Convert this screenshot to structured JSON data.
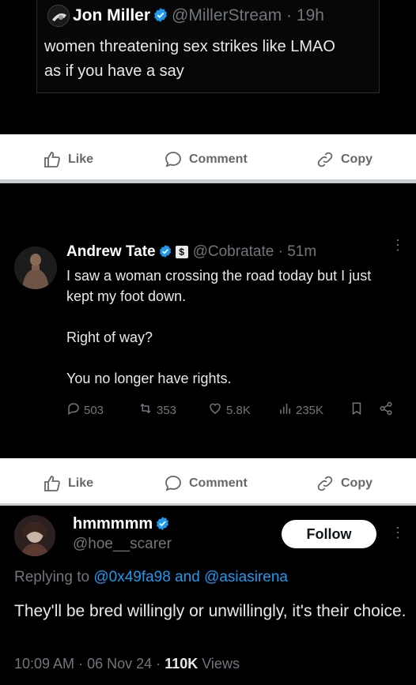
{
  "tweet_top": {
    "name": "Jon Miller",
    "handle": "@MillerStream",
    "sep": "·",
    "time": "19h",
    "text_line1": "women threatening sex strikes like LMAO",
    "text_line2": "as if you have a say"
  },
  "action_bar_1": {
    "like": "Like",
    "comment": "Comment",
    "copy": "Copy"
  },
  "tweet_tate": {
    "name": "Andrew Tate",
    "badge": "$",
    "handle": "@Cobratate",
    "sep": "·",
    "time": "51m",
    "more": "⋮",
    "p1": "I saw a woman crossing the road today but I just kept my foot down.",
    "p2": "Right of way?",
    "p3": "You no longer have rights.",
    "stats": {
      "replies": "503",
      "reposts": "353",
      "likes": "5.8K",
      "views": "235K"
    }
  },
  "action_bar_2": {
    "like": "Like",
    "comment": "Comment",
    "copy": "Copy"
  },
  "tweet_reply": {
    "name": "hmmmmm",
    "handle": "@hoe__scarer",
    "follow": "Follow",
    "more": "⋮",
    "replying_prefix": "Replying to",
    "mention1": "@0x49fa98",
    "and": "and",
    "mention2": "@asiasirena",
    "text": "They'll be bred willingly or unwillingly, it's their choice.",
    "time": "10:09 AM",
    "date": "06 Nov 24",
    "sep": "·",
    "views_count": "110K",
    "views_label": "Views"
  },
  "colors": {
    "background": "#000000",
    "text": "#e7e9ea",
    "muted": "#71767b",
    "link": "#1d9bf0",
    "verified": "#1d9bf0",
    "action_bar_bg": "#ffffff",
    "action_text": "#65676b"
  },
  "icons": [
    "verified-badge-icon",
    "like-thumb-icon",
    "comment-bubble-icon",
    "copy-link-icon",
    "reply-icon",
    "repost-icon",
    "heart-icon",
    "views-icon",
    "bookmark-icon",
    "share-icon",
    "more-vertical-icon"
  ]
}
